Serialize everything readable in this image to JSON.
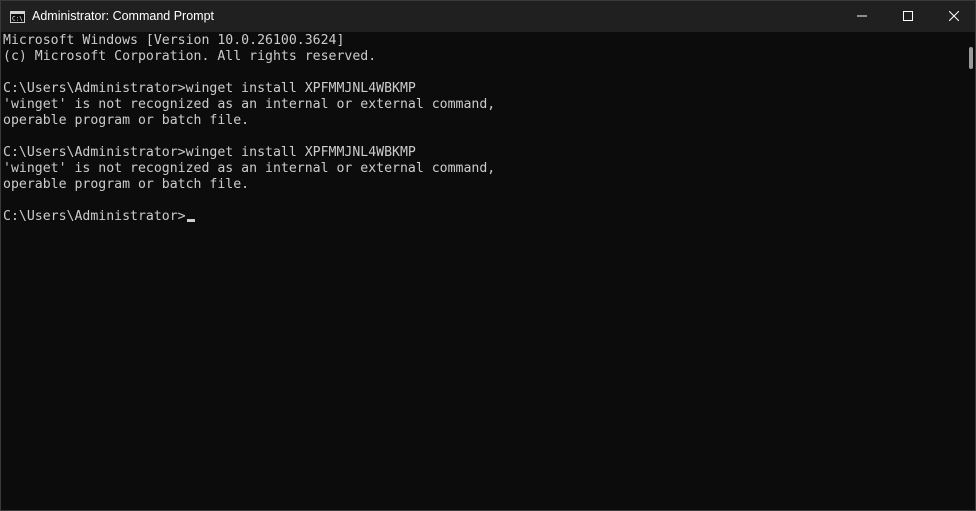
{
  "window": {
    "title": "Administrator: Command Prompt",
    "icon": "cmd-icon",
    "controls": {
      "minimize_icon": "minimize-icon",
      "maximize_icon": "maximize-icon",
      "close_icon": "close-icon"
    }
  },
  "console": {
    "lines": [
      "Microsoft Windows [Version 10.0.26100.3624]",
      "(c) Microsoft Corporation. All rights reserved.",
      "",
      "C:\\Users\\Administrator>winget install XPFMMJNL4WBKMP",
      "'winget' is not recognized as an internal or external command,",
      "operable program or batch file.",
      "",
      "C:\\Users\\Administrator>winget install XPFMMJNL4WBKMP",
      "'winget' is not recognized as an internal or external command,",
      "operable program or batch file.",
      "",
      "C:\\Users\\Administrator>"
    ]
  },
  "colors": {
    "titlebar_bg": "#202020",
    "console_bg": "#0c0c0c",
    "console_text": "#cccccc",
    "title_text": "#ffffff"
  }
}
